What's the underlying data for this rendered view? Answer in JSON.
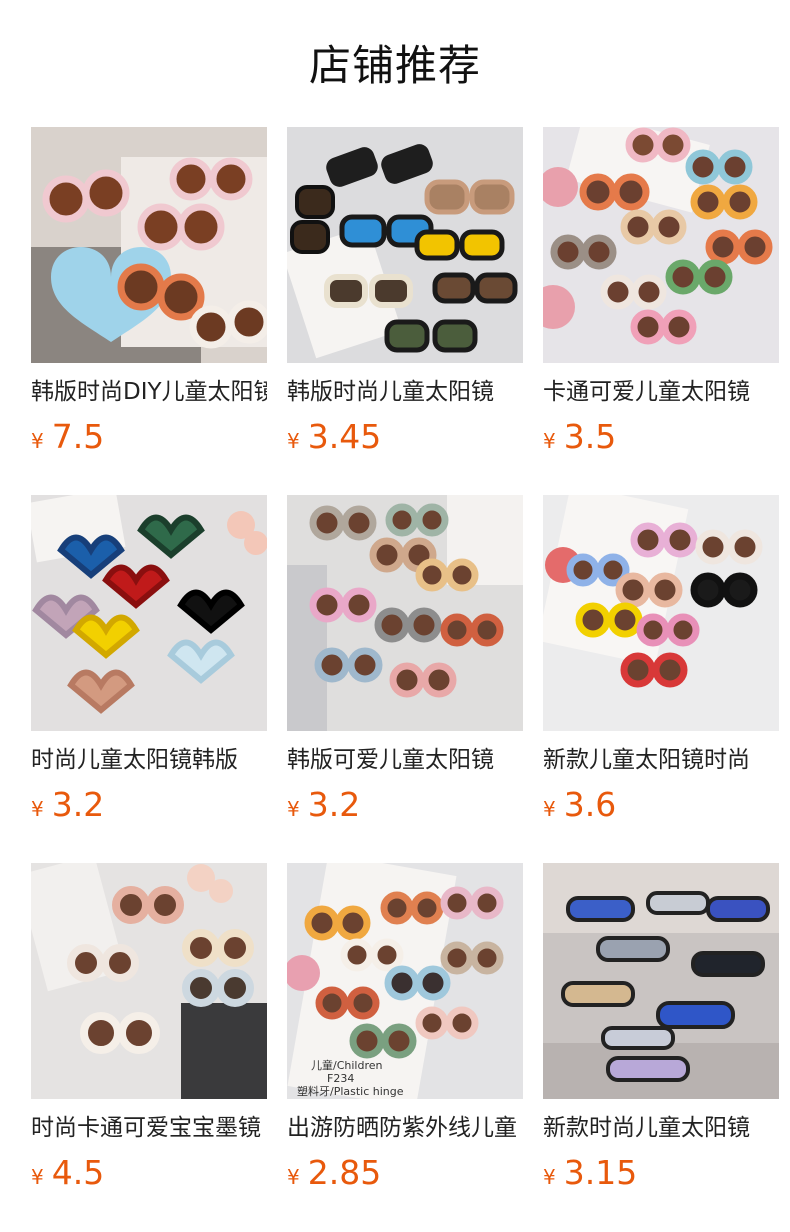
{
  "header": {
    "title": "店铺推荐"
  },
  "currency": "¥",
  "products": [
    {
      "name": "韩版时尚DIY儿童太阳镜",
      "price": "7.5",
      "image": "sunglasses-photo",
      "bg": "#d9d2cc"
    },
    {
      "name": "韩版时尚儿童太阳镜",
      "price": "3.45",
      "image": "sunglasses-photo",
      "bg": "#dcdcde"
    },
    {
      "name": "卡通可爱儿童太阳镜",
      "price": "3.5",
      "image": "sunglasses-photo",
      "bg": "#e6e4e8"
    },
    {
      "name": "时尚儿童太阳镜韩版",
      "price": "3.2",
      "image": "sunglasses-photo",
      "bg": "#e2e0e0"
    },
    {
      "name": "韩版可爱儿童太阳镜",
      "price": "3.2",
      "image": "sunglasses-photo",
      "bg": "#dfdedd"
    },
    {
      "name": "新款儿童太阳镜时尚",
      "price": "3.6",
      "image": "sunglasses-photo",
      "bg": "#ececed"
    },
    {
      "name": "时尚卡通可爱宝宝墨镜",
      "price": "4.5",
      "image": "sunglasses-photo",
      "bg": "#e5e3e2"
    },
    {
      "name": "出游防晒防紫外线儿童",
      "price": "2.85",
      "image": "sunglasses-photo",
      "bg": "#e3e3e5"
    },
    {
      "name": "新款时尚儿童太阳镜",
      "price": "3.15",
      "image": "sunglasses-photo",
      "bg": "#c9c4c2"
    }
  ],
  "thumb_text": {
    "p8_line1": "儿童/Children",
    "p8_line2": "F234",
    "p8_line3": "塑料牙/Plastic hinge"
  },
  "colors": {
    "price": "#e8590c",
    "title": "#111111",
    "name": "#222222"
  }
}
